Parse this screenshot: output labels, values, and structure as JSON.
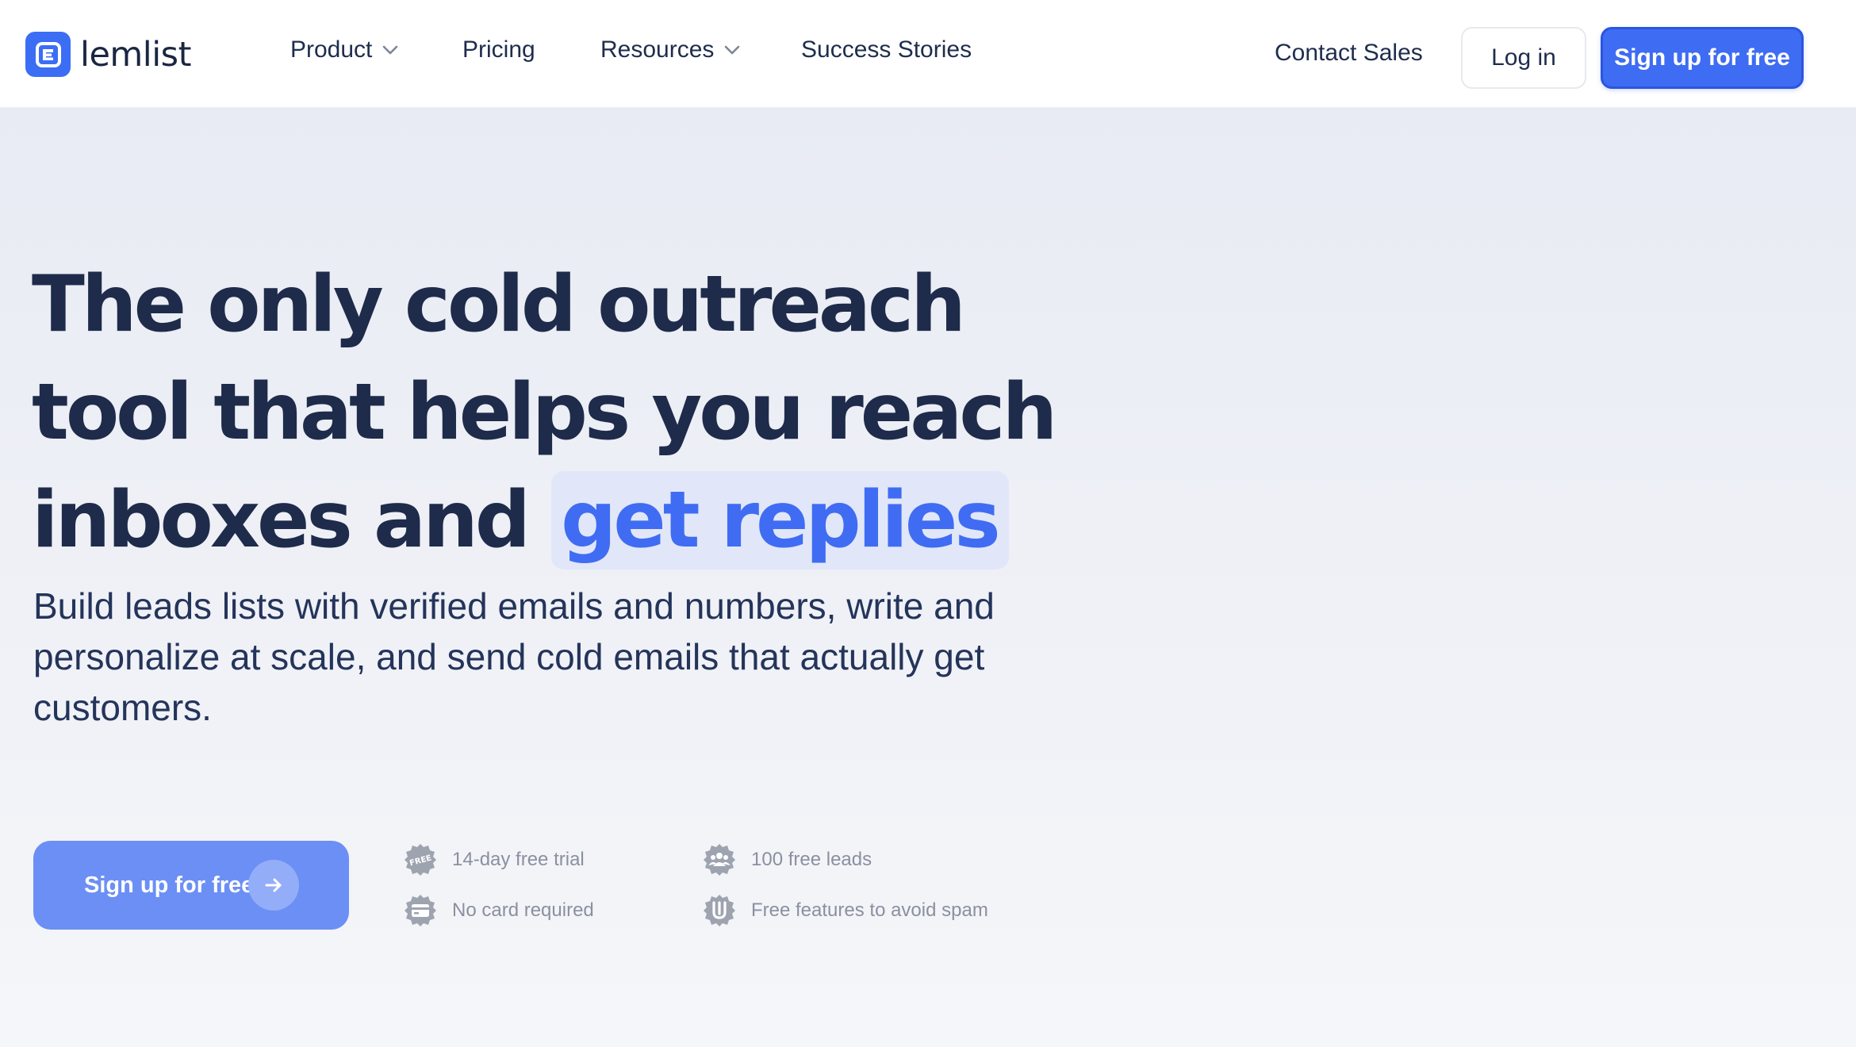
{
  "brand": {
    "name": "lemlist",
    "accent": "#3b6ef5",
    "logo_icon": "lemlist-logo-icon"
  },
  "nav": {
    "items": [
      {
        "label": "Product",
        "has_dropdown": true
      },
      {
        "label": "Pricing",
        "has_dropdown": false
      },
      {
        "label": "Resources",
        "has_dropdown": true
      },
      {
        "label": "Success Stories",
        "has_dropdown": false
      }
    ],
    "contact_sales": "Contact Sales",
    "login": "Log in",
    "signup": "Sign up for free"
  },
  "hero": {
    "headline_line1": "The only cold outreach",
    "headline_line2": "tool that helps you reach",
    "headline_line3_prefix": "inboxes and",
    "headline_highlight": "get replies",
    "subtext": "Build leads lists with verified emails and numbers, write and personalize at scale, and send cold emails that actually get customers.",
    "cta_label": "Sign up for free",
    "cta_icon": "arrow-right-icon",
    "features": [
      {
        "label": "14-day free trial",
        "icon": "free-badge-icon"
      },
      {
        "label": "No card required",
        "icon": "credit-card-badge-icon"
      },
      {
        "label": "100 free leads",
        "icon": "people-badge-icon"
      },
      {
        "label": "Free features to avoid spam",
        "icon": "shield-badge-icon"
      }
    ]
  },
  "colors": {
    "primary_button": "#3e6cf3",
    "cta_button": "#6b8ff5",
    "heading_text": "#1e2b4a",
    "highlight_text": "#3f6cf2",
    "highlight_bg": "#e1e7f8",
    "feature_text": "#8a90a0"
  }
}
